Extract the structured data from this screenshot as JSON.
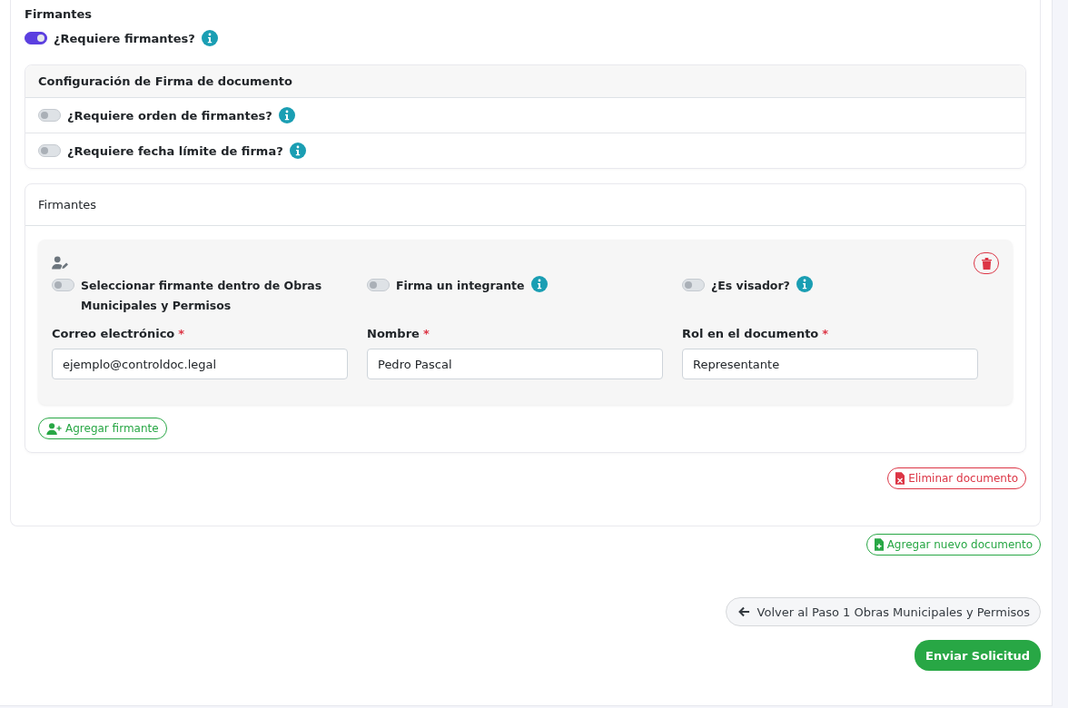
{
  "section_title": "Firmantes",
  "require_signers": {
    "label": "¿Requiere firmantes?",
    "on": true,
    "info": true
  },
  "config": {
    "title": "Configuración de Firma de documento",
    "options": [
      {
        "label": "¿Requiere orden de firmantes?",
        "on": false,
        "info": true
      },
      {
        "label": "¿Requiere fecha límite de firma?",
        "on": false,
        "info": true
      }
    ]
  },
  "signers_panel": {
    "title": "Firmantes",
    "signers": [
      {
        "toggles": [
          {
            "label": "Seleccionar firmante dentro de Obras Municipales y Permisos",
            "on": false,
            "info": false
          },
          {
            "label": "Firma un integrante",
            "on": false,
            "info": true
          },
          {
            "label": "¿Es visador?",
            "on": false,
            "info": true
          }
        ],
        "fields": [
          {
            "label": "Correo electrónico",
            "required_mark": "*",
            "value": "ejemplo@controldoc.legal"
          },
          {
            "label": "Nombre",
            "required_mark": "*",
            "value": "Pedro Pascal"
          },
          {
            "label": "Rol en el documento",
            "required_mark": "*",
            "value": "Representante"
          }
        ]
      }
    ],
    "add_button": "Agregar firmante"
  },
  "delete_document_button": "Eliminar documento",
  "add_document_button": "Agregar nuevo documento",
  "back_button": "Volver al Paso 1 Obras Municipales y Permisos",
  "submit_button": "Enviar Solicitud"
}
